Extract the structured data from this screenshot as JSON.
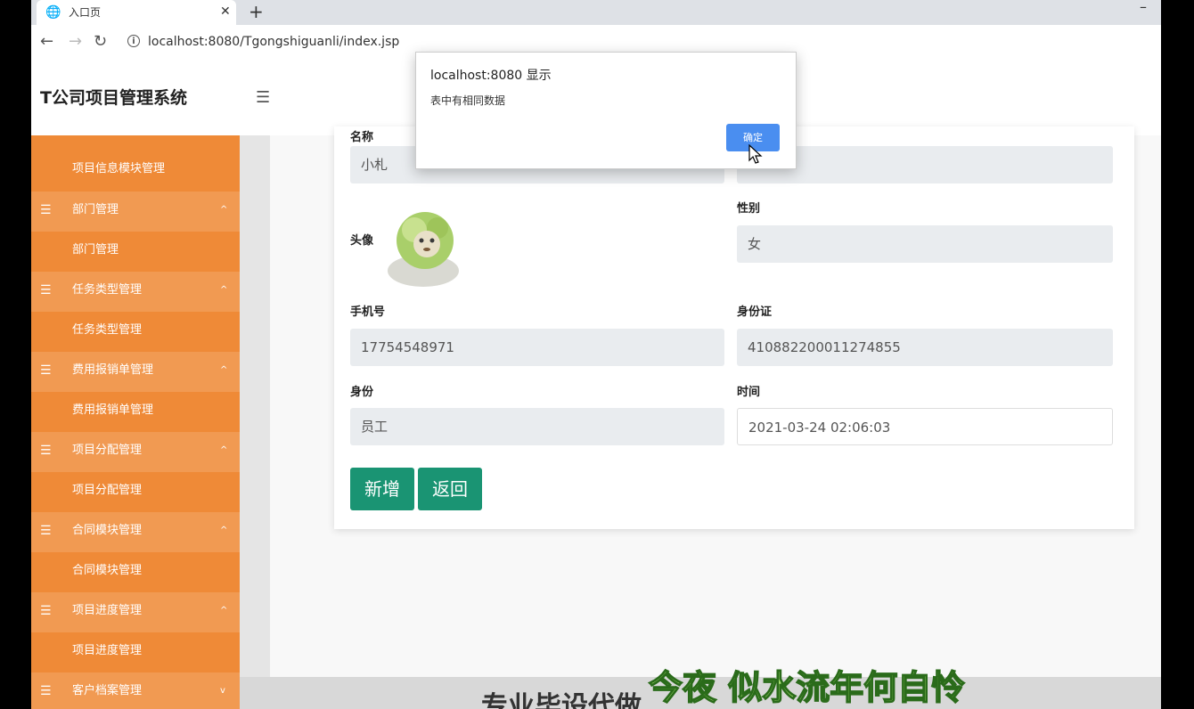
{
  "browser": {
    "tab_title": "入口页",
    "tab_close": "✕",
    "new_tab": "+",
    "minimize": "–",
    "url": "localhost:8080/Tgongshiguanli/index.jsp"
  },
  "app": {
    "title": "T公司项目管理系统"
  },
  "sidebar": {
    "items": [
      {
        "label": "项目信息模块管理",
        "type": "sub"
      },
      {
        "label": "部门管理",
        "type": "group",
        "caret": "^"
      },
      {
        "label": "部门管理",
        "type": "sub"
      },
      {
        "label": "任务类型管理",
        "type": "group",
        "caret": "^"
      },
      {
        "label": "任务类型管理",
        "type": "sub"
      },
      {
        "label": "费用报销单管理",
        "type": "group",
        "caret": "^"
      },
      {
        "label": "费用报销单管理",
        "type": "sub"
      },
      {
        "label": "项目分配管理",
        "type": "group",
        "caret": "^"
      },
      {
        "label": "项目分配管理",
        "type": "sub"
      },
      {
        "label": "合同模块管理",
        "type": "group",
        "caret": "^"
      },
      {
        "label": "合同模块管理",
        "type": "sub"
      },
      {
        "label": "项目进度管理",
        "type": "group",
        "caret": "^"
      },
      {
        "label": "项目进度管理",
        "type": "sub"
      },
      {
        "label": "客户档案管理",
        "type": "group",
        "caret": "v"
      }
    ]
  },
  "form": {
    "name_label": "名称",
    "name_value": "小札",
    "second_value": "222",
    "avatar_label": "头像",
    "gender_label": "性别",
    "gender_value": "女",
    "phone_label": "手机号",
    "phone_value": "17754548971",
    "idcard_label": "身份证",
    "idcard_value": "410882200011274855",
    "role_label": "身份",
    "role_value": "员工",
    "time_label": "时间",
    "time_value": "2021-03-24 02:06:03",
    "add_button": "新增",
    "back_button": "返回"
  },
  "alert": {
    "title": "localhost:8080 显示",
    "message": "表中有相同数据",
    "ok_button": "确定"
  },
  "overlay": {
    "caption": "今夜 似水流年何自怜",
    "footer_text": "专业毕设代做"
  }
}
